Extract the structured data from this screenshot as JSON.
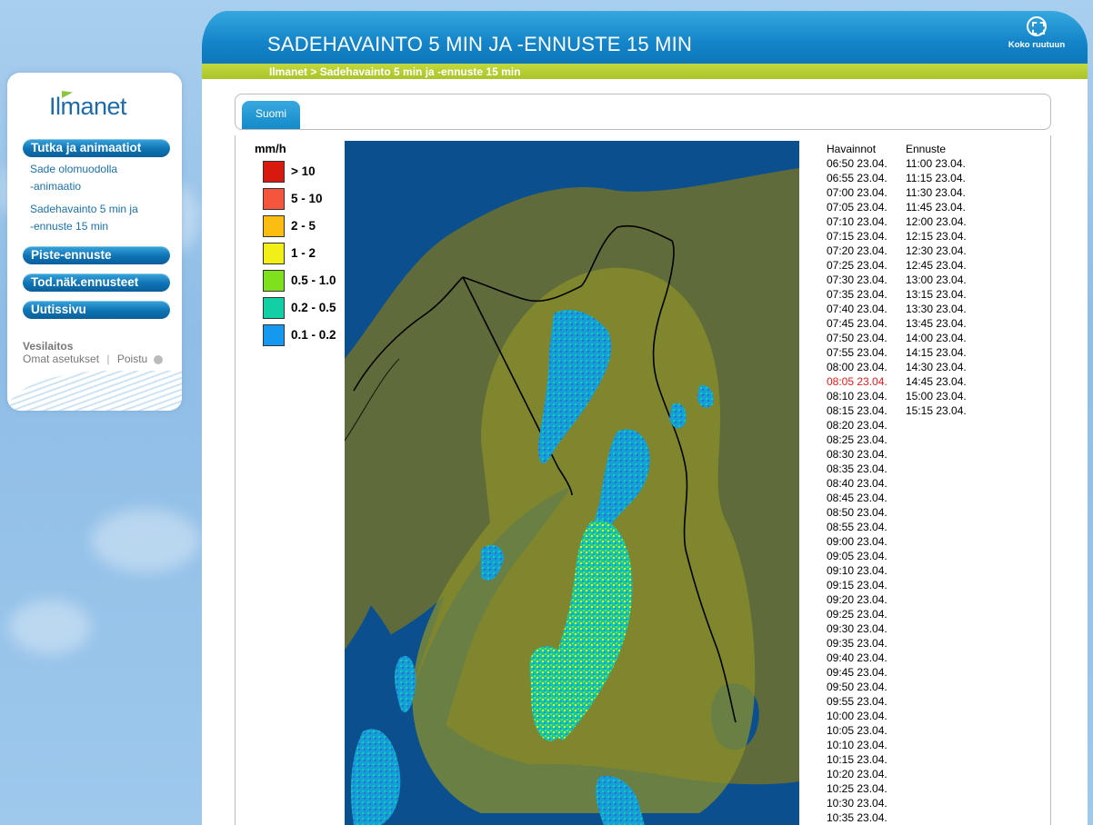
{
  "header": {
    "title": "SADEHAVAINTO 5 MIN JA -ENNUSTE 15 MIN",
    "fullscreen_label": "Koko ruutuun"
  },
  "breadcrumb": "Ilmanet > Sadehavainto 5 min ja -ennuste 15 min",
  "sidebar": {
    "logo": "Ilmanet",
    "sections": [
      {
        "label": "Tutka ja animaatiot"
      },
      {
        "label": "Piste-ennuste"
      },
      {
        "label": "Tod.näk.ennusteet"
      },
      {
        "label": "Uutissivu"
      }
    ],
    "sub_links": [
      {
        "line1": "Sade olomuodolla",
        "line2": "-animaatio"
      },
      {
        "line1": "Sadehavainto 5 min ja",
        "line2": "-ennuste 15 min"
      }
    ],
    "user": {
      "name": "Vesilaitos",
      "settings": "Omat asetukset",
      "separator": "|",
      "logout": "Poistu"
    }
  },
  "tabs": [
    {
      "label": "Suomi",
      "active": true
    }
  ],
  "legend": {
    "unit": "mm/h",
    "items": [
      {
        "label": "> 10",
        "color": "#d7190f"
      },
      {
        "label": "5 - 10",
        "color": "#f5553c"
      },
      {
        "label": "2 - 5",
        "color": "#fbbd12"
      },
      {
        "label": "1 - 2",
        "color": "#f2ee17"
      },
      {
        "label": "0.5 - 1.0",
        "color": "#7fe01e"
      },
      {
        "label": "0.2 - 0.5",
        "color": "#12cfa6"
      },
      {
        "label": "0.1 - 0.2",
        "color": "#1599f0"
      }
    ]
  },
  "observations": {
    "heading": "Havainnot",
    "current": "08:05 23.04.",
    "times": [
      "06:50 23.04.",
      "06:55 23.04.",
      "07:00 23.04.",
      "07:05 23.04.",
      "07:10 23.04.",
      "07:15 23.04.",
      "07:20 23.04.",
      "07:25 23.04.",
      "07:30 23.04.",
      "07:35 23.04.",
      "07:40 23.04.",
      "07:45 23.04.",
      "07:50 23.04.",
      "07:55 23.04.",
      "08:00 23.04.",
      "08:05 23.04.",
      "08:10 23.04.",
      "08:15 23.04.",
      "08:20 23.04.",
      "08:25 23.04.",
      "08:30 23.04.",
      "08:35 23.04.",
      "08:40 23.04.",
      "08:45 23.04.",
      "08:50 23.04.",
      "08:55 23.04.",
      "09:00 23.04.",
      "09:05 23.04.",
      "09:10 23.04.",
      "09:15 23.04.",
      "09:20 23.04.",
      "09:25 23.04.",
      "09:30 23.04.",
      "09:35 23.04.",
      "09:40 23.04.",
      "09:45 23.04.",
      "09:50 23.04.",
      "09:55 23.04.",
      "10:00 23.04.",
      "10:05 23.04.",
      "10:10 23.04.",
      "10:15 23.04.",
      "10:20 23.04.",
      "10:25 23.04.",
      "10:30 23.04.",
      "10:35 23.04."
    ]
  },
  "forecast": {
    "heading": "Ennuste",
    "times": [
      "11:00 23.04.",
      "11:15 23.04.",
      "11:30 23.04.",
      "11:45 23.04.",
      "12:00 23.04.",
      "12:15 23.04.",
      "12:30 23.04.",
      "12:45 23.04.",
      "13:00 23.04.",
      "13:15 23.04.",
      "13:30 23.04.",
      "13:45 23.04.",
      "14:00 23.04.",
      "14:15 23.04.",
      "14:30 23.04.",
      "14:45 23.04.",
      "15:00 23.04.",
      "15:15 23.04."
    ]
  },
  "map": {
    "sea_color": "#0b4f8f",
    "land_color": "#5f6b3a",
    "coverage_color": "#8a8f2a",
    "border_color": "#000000"
  }
}
